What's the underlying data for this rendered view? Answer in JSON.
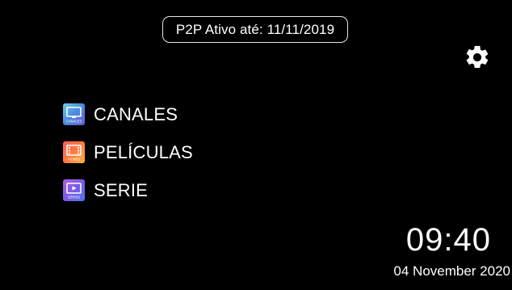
{
  "status": {
    "text": "P2P Ativo até: 11/11/2019"
  },
  "settings": {
    "icon": "gear-icon"
  },
  "menu": {
    "items": [
      {
        "label": "CANALES",
        "icon": "tv-icon",
        "icon_text": "CANALES"
      },
      {
        "label": "PELÍCULAS",
        "icon": "film-icon",
        "icon_text": "FILMES"
      },
      {
        "label": "SERIE",
        "icon": "series-play-icon",
        "icon_text": "SERIES"
      }
    ]
  },
  "clock": {
    "time": "09:40",
    "date": "04 November 2020"
  },
  "colors": {
    "background": "#000000",
    "text": "#ffffff",
    "pill_border": "#e6e6e6"
  }
}
